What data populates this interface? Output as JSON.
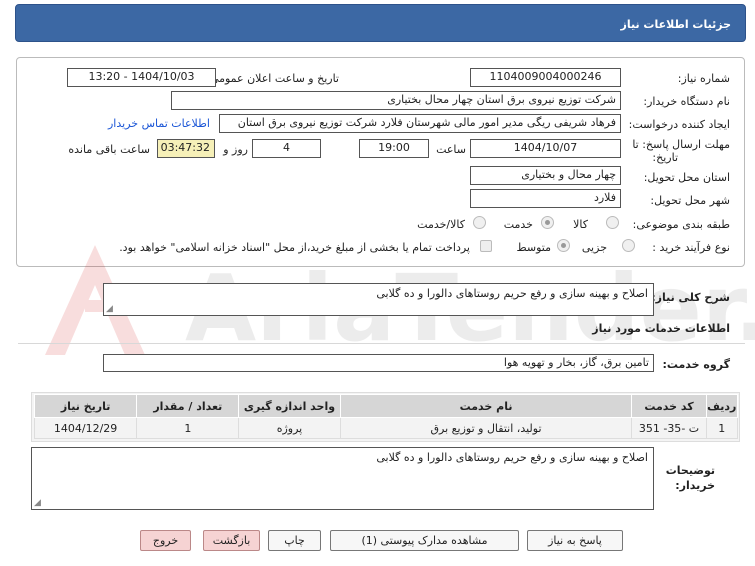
{
  "header": {
    "title": "جزئیات اطلاعات نیاز"
  },
  "form": {
    "need_number_label": "شماره نیاز:",
    "need_number": "1104009004000246",
    "announce_label": "تاریخ و ساعت اعلان عمومی:",
    "announce_value": "1404/10/03 - 13:20",
    "buyer_org_label": "نام دستگاه خریدار:",
    "buyer_org": "شرکت توزیع نیروی برق استان چهار محال بختیاری",
    "creator_label": "ایجاد کننده درخواست:",
    "creator": "فرهاد شریفی ریگی مدیر امور مالی شهرستان فلارد شرکت توزیع نیروی برق استان",
    "contact_link": "اطلاعات تماس خریدار",
    "deadline_label_1": "مهلت ارسال پاسخ: تا",
    "deadline_label_2": "تاریخ:",
    "deadline_date": "1404/10/07",
    "time_label": "ساعت",
    "deadline_time": "19:00",
    "days_value": "4",
    "days_label": "روز و",
    "remaining_time": "03:47:32",
    "remaining_label": "ساعت باقی مانده",
    "province_label": "استان محل تحویل:",
    "province": "چهار محال و بختیاری",
    "city_label": "شهر محل تحویل:",
    "city": "فلارد",
    "category_label": "طبقه بندی موضوعی:",
    "category_options": [
      "کالا",
      "خدمت",
      "کالا/خدمت"
    ],
    "process_label": "نوع فرآیند خرید :",
    "process_options": [
      "جزیی",
      "متوسط"
    ],
    "payment_note": "پرداخت تمام یا بخشی از مبلغ خرید،از محل \"اسناد خزانه اسلامی\" خواهد بود."
  },
  "summary": {
    "label": "شرح کلی نیاز:",
    "text": "اصلاح و بهینه سازی و رفع حریم روستاهای دالورا و ده گلابی"
  },
  "services": {
    "section_title": "اطلاعات خدمات مورد نیاز",
    "group_label": "گروه خدمت:",
    "group_value": "تامین برق، گاز، بخار و تهویه هوا",
    "columns": [
      "ردیف",
      "کد خدمت",
      "نام خدمت",
      "واحد اندازه گیری",
      "تعداد / مقدار",
      "تاریخ نیاز"
    ],
    "rows": [
      {
        "row": "1",
        "code": "ت -35- 351",
        "name": "تولید، انتقال و توزیع برق",
        "unit": "پروژه",
        "qty": "1",
        "date": "1404/12/29"
      }
    ]
  },
  "buyer_notes": {
    "label_1": "توضیحات",
    "label_2": "خریدار:",
    "text": "اصلاح و بهینه سازی و رفع حریم روستاهای دالورا و ده گلابی"
  },
  "buttons": {
    "reply": "پاسخ به نیاز",
    "attachments": "مشاهده مدارک پیوستی (1)",
    "print": "چاپ",
    "back": "بازگشت",
    "exit": "خروج"
  },
  "watermark": {
    "text": "AriaTender.net"
  },
  "colors": {
    "header": "#3c68a4",
    "link": "#1a55d6",
    "timer_bg": "#f6f0b8",
    "pink_button": "#f6d3d3"
  }
}
